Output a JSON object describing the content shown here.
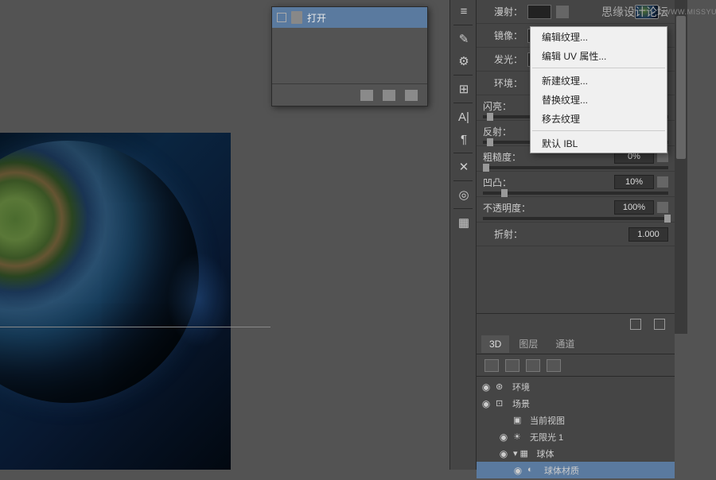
{
  "watermark": {
    "main": "思缘设计论坛",
    "sub": "WWW.MISSYUAN.COM"
  },
  "popup": {
    "item": "打开"
  },
  "props": {
    "diffuse": "漫射：",
    "specular": "镜像：",
    "glow": "发光：",
    "env": "环境：",
    "shine": "闪亮：",
    "reflect": "反射：",
    "roughness": {
      "label": "粗糙度：",
      "value": "0%"
    },
    "bump": {
      "label": "凹凸：",
      "value": "10%"
    },
    "opacity": {
      "label": "不透明度：",
      "value": "100%"
    },
    "refraction": {
      "label": "折射：",
      "value": "1.000"
    }
  },
  "context_menu": {
    "edit_texture": "编辑纹理...",
    "edit_uv": "编辑 UV 属性...",
    "new_texture": "新建纹理...",
    "replace_texture": "替换纹理...",
    "remove_texture": "移去纹理",
    "default_ibl": "默认 IBL"
  },
  "panel3d": {
    "tabs": {
      "d3": "3D",
      "layers": "图层",
      "channels": "通道"
    },
    "tree": {
      "environment": "环境",
      "scene": "场景",
      "current_view": "当前视图",
      "infinite_light": "无限光 1",
      "sphere": "球体",
      "sphere_material": "球体材质"
    }
  }
}
